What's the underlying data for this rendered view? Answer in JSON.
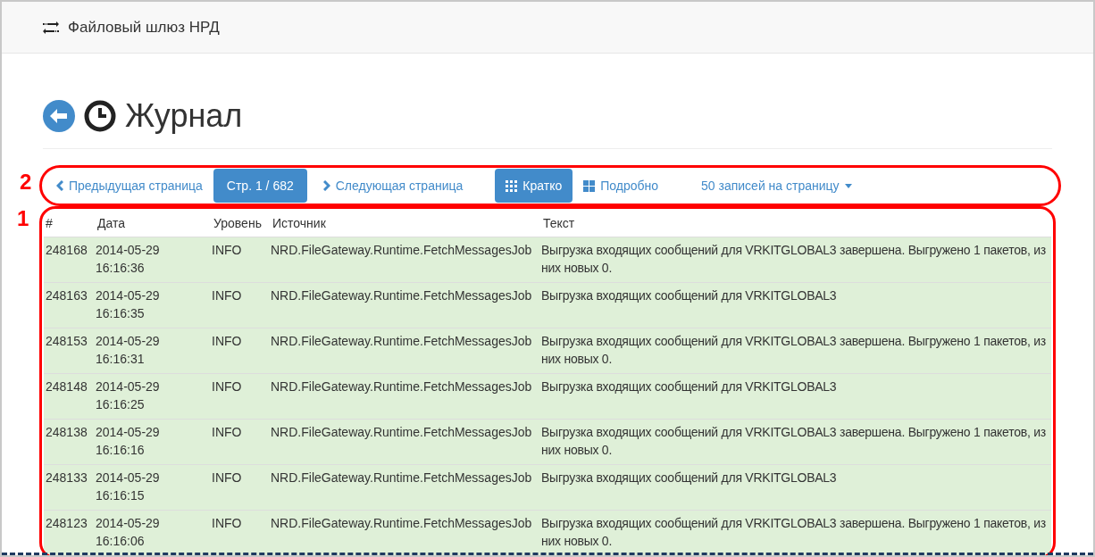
{
  "navbar": {
    "brand": "Файловый шлюз НРД"
  },
  "page": {
    "title": "Журнал"
  },
  "toolbar": {
    "annotation": "2",
    "prev": "Предыдущая страница",
    "page": "Стр. 1 / 682",
    "next": "Следующая страница",
    "views": [
      {
        "label": "Кратко",
        "selected": true,
        "kind": "grid"
      },
      {
        "label": "Подробно",
        "selected": false,
        "kind": "tiles"
      }
    ],
    "page_size": "50 записей на страницу"
  },
  "table": {
    "annotation": "1",
    "columns": [
      "#",
      "Дата",
      "Уровень",
      "Источник",
      "Текст"
    ],
    "rows": [
      {
        "id": "248168",
        "date": "2014-05-29",
        "time": "16:16:36",
        "level": "INFO",
        "source": "NRD.FileGateway.Runtime.FetchMessagesJob",
        "text": "Выгрузка входящих сообщений для VRKITGLOBAL3 завершена. Выгружено 1 пакетов, из них новых 0."
      },
      {
        "id": "248163",
        "date": "2014-05-29",
        "time": "16:16:35",
        "level": "INFO",
        "source": "NRD.FileGateway.Runtime.FetchMessagesJob",
        "text": "Выгрузка входящих сообщений для VRKITGLOBAL3"
      },
      {
        "id": "248153",
        "date": "2014-05-29",
        "time": "16:16:31",
        "level": "INFO",
        "source": "NRD.FileGateway.Runtime.FetchMessagesJob",
        "text": "Выгрузка входящих сообщений для VRKITGLOBAL3 завершена. Выгружено 1 пакетов, из них новых 0."
      },
      {
        "id": "248148",
        "date": "2014-05-29",
        "time": "16:16:25",
        "level": "INFO",
        "source": "NRD.FileGateway.Runtime.FetchMessagesJob",
        "text": "Выгрузка входящих сообщений для VRKITGLOBAL3"
      },
      {
        "id": "248138",
        "date": "2014-05-29",
        "time": "16:16:16",
        "level": "INFO",
        "source": "NRD.FileGateway.Runtime.FetchMessagesJob",
        "text": "Выгрузка входящих сообщений для VRKITGLOBAL3 завершена. Выгружено 1 пакетов, из них новых 0."
      },
      {
        "id": "248133",
        "date": "2014-05-29",
        "time": "16:16:15",
        "level": "INFO",
        "source": "NRD.FileGateway.Runtime.FetchMessagesJob",
        "text": "Выгрузка входящих сообщений для VRKITGLOBAL3"
      },
      {
        "id": "248123",
        "date": "2014-05-29",
        "time": "16:16:06",
        "level": "INFO",
        "source": "NRD.FileGateway.Runtime.FetchMessagesJob",
        "text": "Выгрузка входящих сообщений для VRKITGLOBAL3 завершена. Выгружено 1 пакетов, из них новых 0."
      }
    ]
  }
}
